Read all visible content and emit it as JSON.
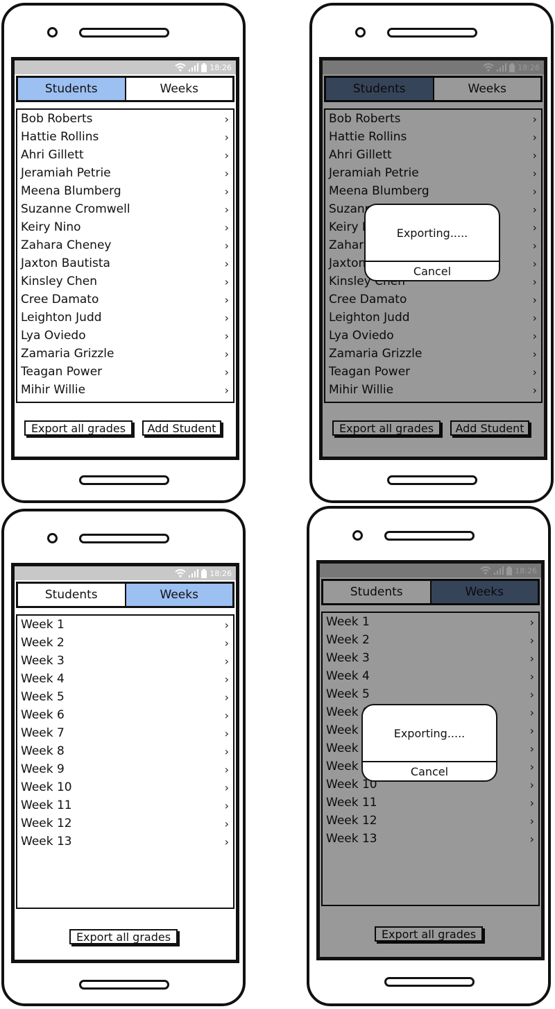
{
  "status": {
    "time": "18:26"
  },
  "tabs": {
    "students": "Students",
    "weeks": "Weeks"
  },
  "students": [
    "Bob Roberts",
    "Hattie Rollins",
    "Ahri Gillett",
    "Jeramiah Petrie",
    "Meena Blumberg",
    "Suzanne Cromwell",
    "Keiry Nino",
    "Zahara Cheney",
    "Jaxton Bautista",
    "Kinsley Chen",
    "Cree Damato",
    "Leighton Judd",
    "Lya Oviedo",
    "Zamaria Grizzle",
    "Teagan Power",
    "Mihir Willie"
  ],
  "weeks": [
    "Week 1",
    "Week 2",
    "Week 3",
    "Week 4",
    "Week 5",
    "Week 6",
    "Week 7",
    "Week 8",
    "Week 9",
    "Week 10",
    "Week 11",
    "Week 12",
    "Week 13"
  ],
  "buttons": {
    "export": "Export all grades",
    "add_student": "Add Student"
  },
  "dialog": {
    "message": "Exporting.....",
    "cancel": "Cancel"
  },
  "colors": {
    "active_tab": "#9dc0f2",
    "active_tab_dimmed": "#5a7294",
    "overlay": "#7a7a7a"
  },
  "icons": {
    "chevron": "chevron-right-icon",
    "wifi": "wifi-icon",
    "signal": "signal-icon",
    "battery": "battery-icon"
  }
}
